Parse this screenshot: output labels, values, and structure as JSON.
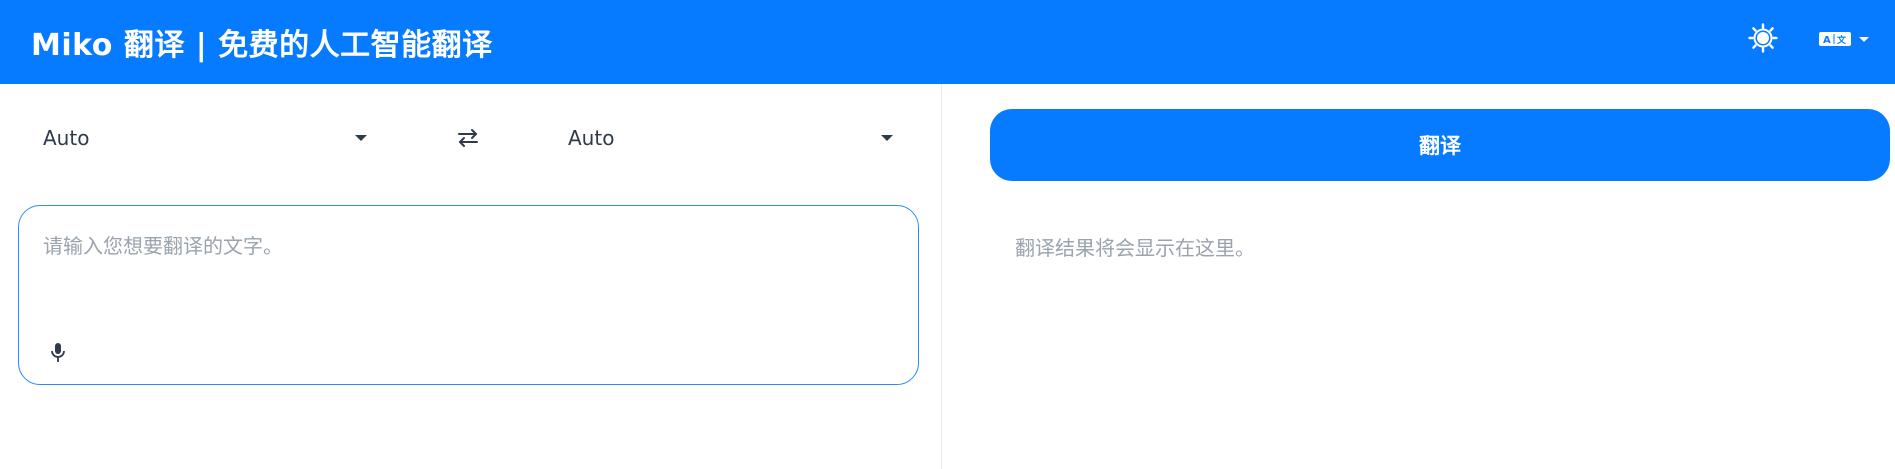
{
  "header": {
    "title": "Miko 翻译 | 免费的人工智能翻译",
    "theme_icon": "sun-icon",
    "language_icon": "translate-language-icon"
  },
  "languages": {
    "source_value": "Auto",
    "target_value": "Auto",
    "swap_icon": "swap-arrows-icon"
  },
  "input": {
    "placeholder": "请输入您想要翻译的文字。",
    "value": "",
    "mic_icon": "microphone-icon"
  },
  "actions": {
    "translate_label": "翻译"
  },
  "output": {
    "result_placeholder": "翻译结果将会显示在这里。"
  },
  "colors": {
    "primary": "#077bff",
    "input_border": "#2b8cf7",
    "placeholder_text": "#9aa3ae",
    "body_text": "#2f3a4a"
  }
}
